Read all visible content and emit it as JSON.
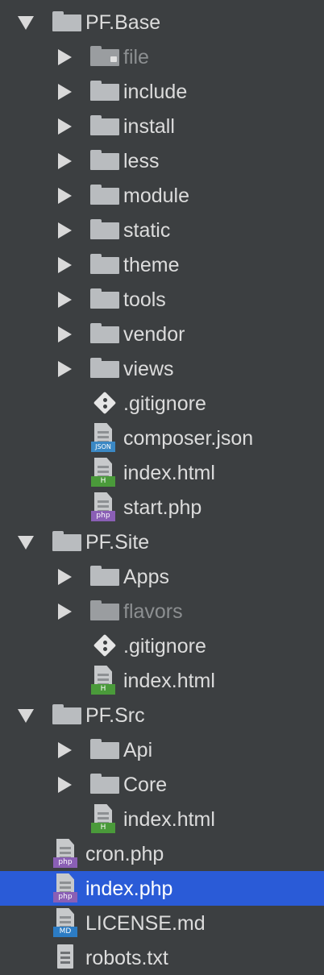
{
  "tree": {
    "pf_base": {
      "label": "PF.Base",
      "children": [
        "file",
        "include",
        "install",
        "less",
        "module",
        "static",
        "theme",
        "tools",
        "vendor",
        "views"
      ],
      "files": [
        {
          "name": ".gitignore",
          "icon": "git-icon"
        },
        {
          "name": "composer.json",
          "icon": "json-file-icon",
          "badge": "JSON"
        },
        {
          "name": "index.html",
          "icon": "html-file-icon",
          "badge": "H"
        },
        {
          "name": "start.php",
          "icon": "php-file-icon",
          "badge": "php"
        }
      ]
    },
    "pf_site": {
      "label": "PF.Site",
      "children": [
        "Apps",
        "flavors"
      ],
      "files": [
        {
          "name": ".gitignore",
          "icon": "git-icon"
        },
        {
          "name": "index.html",
          "icon": "html-file-icon",
          "badge": "H"
        }
      ]
    },
    "pf_src": {
      "label": "PF.Src",
      "children": [
        "Api",
        "Core"
      ],
      "files": [
        {
          "name": "index.html",
          "icon": "html-file-icon",
          "badge": "H"
        }
      ]
    },
    "root_files": [
      {
        "name": "cron.php",
        "icon": "php-file-icon",
        "badge": "php"
      },
      {
        "name": "index.php",
        "icon": "php-file-icon",
        "badge": "php",
        "selected": true
      },
      {
        "name": "LICENSE.md",
        "icon": "md-file-icon",
        "badge": "MD"
      },
      {
        "name": "robots.txt",
        "icon": "text-file-icon"
      }
    ]
  },
  "colors": {
    "background": "#3c3f41",
    "selection": "#2a5bd7",
    "text": "#dcdcdc",
    "muted_text": "#8c8f91"
  }
}
